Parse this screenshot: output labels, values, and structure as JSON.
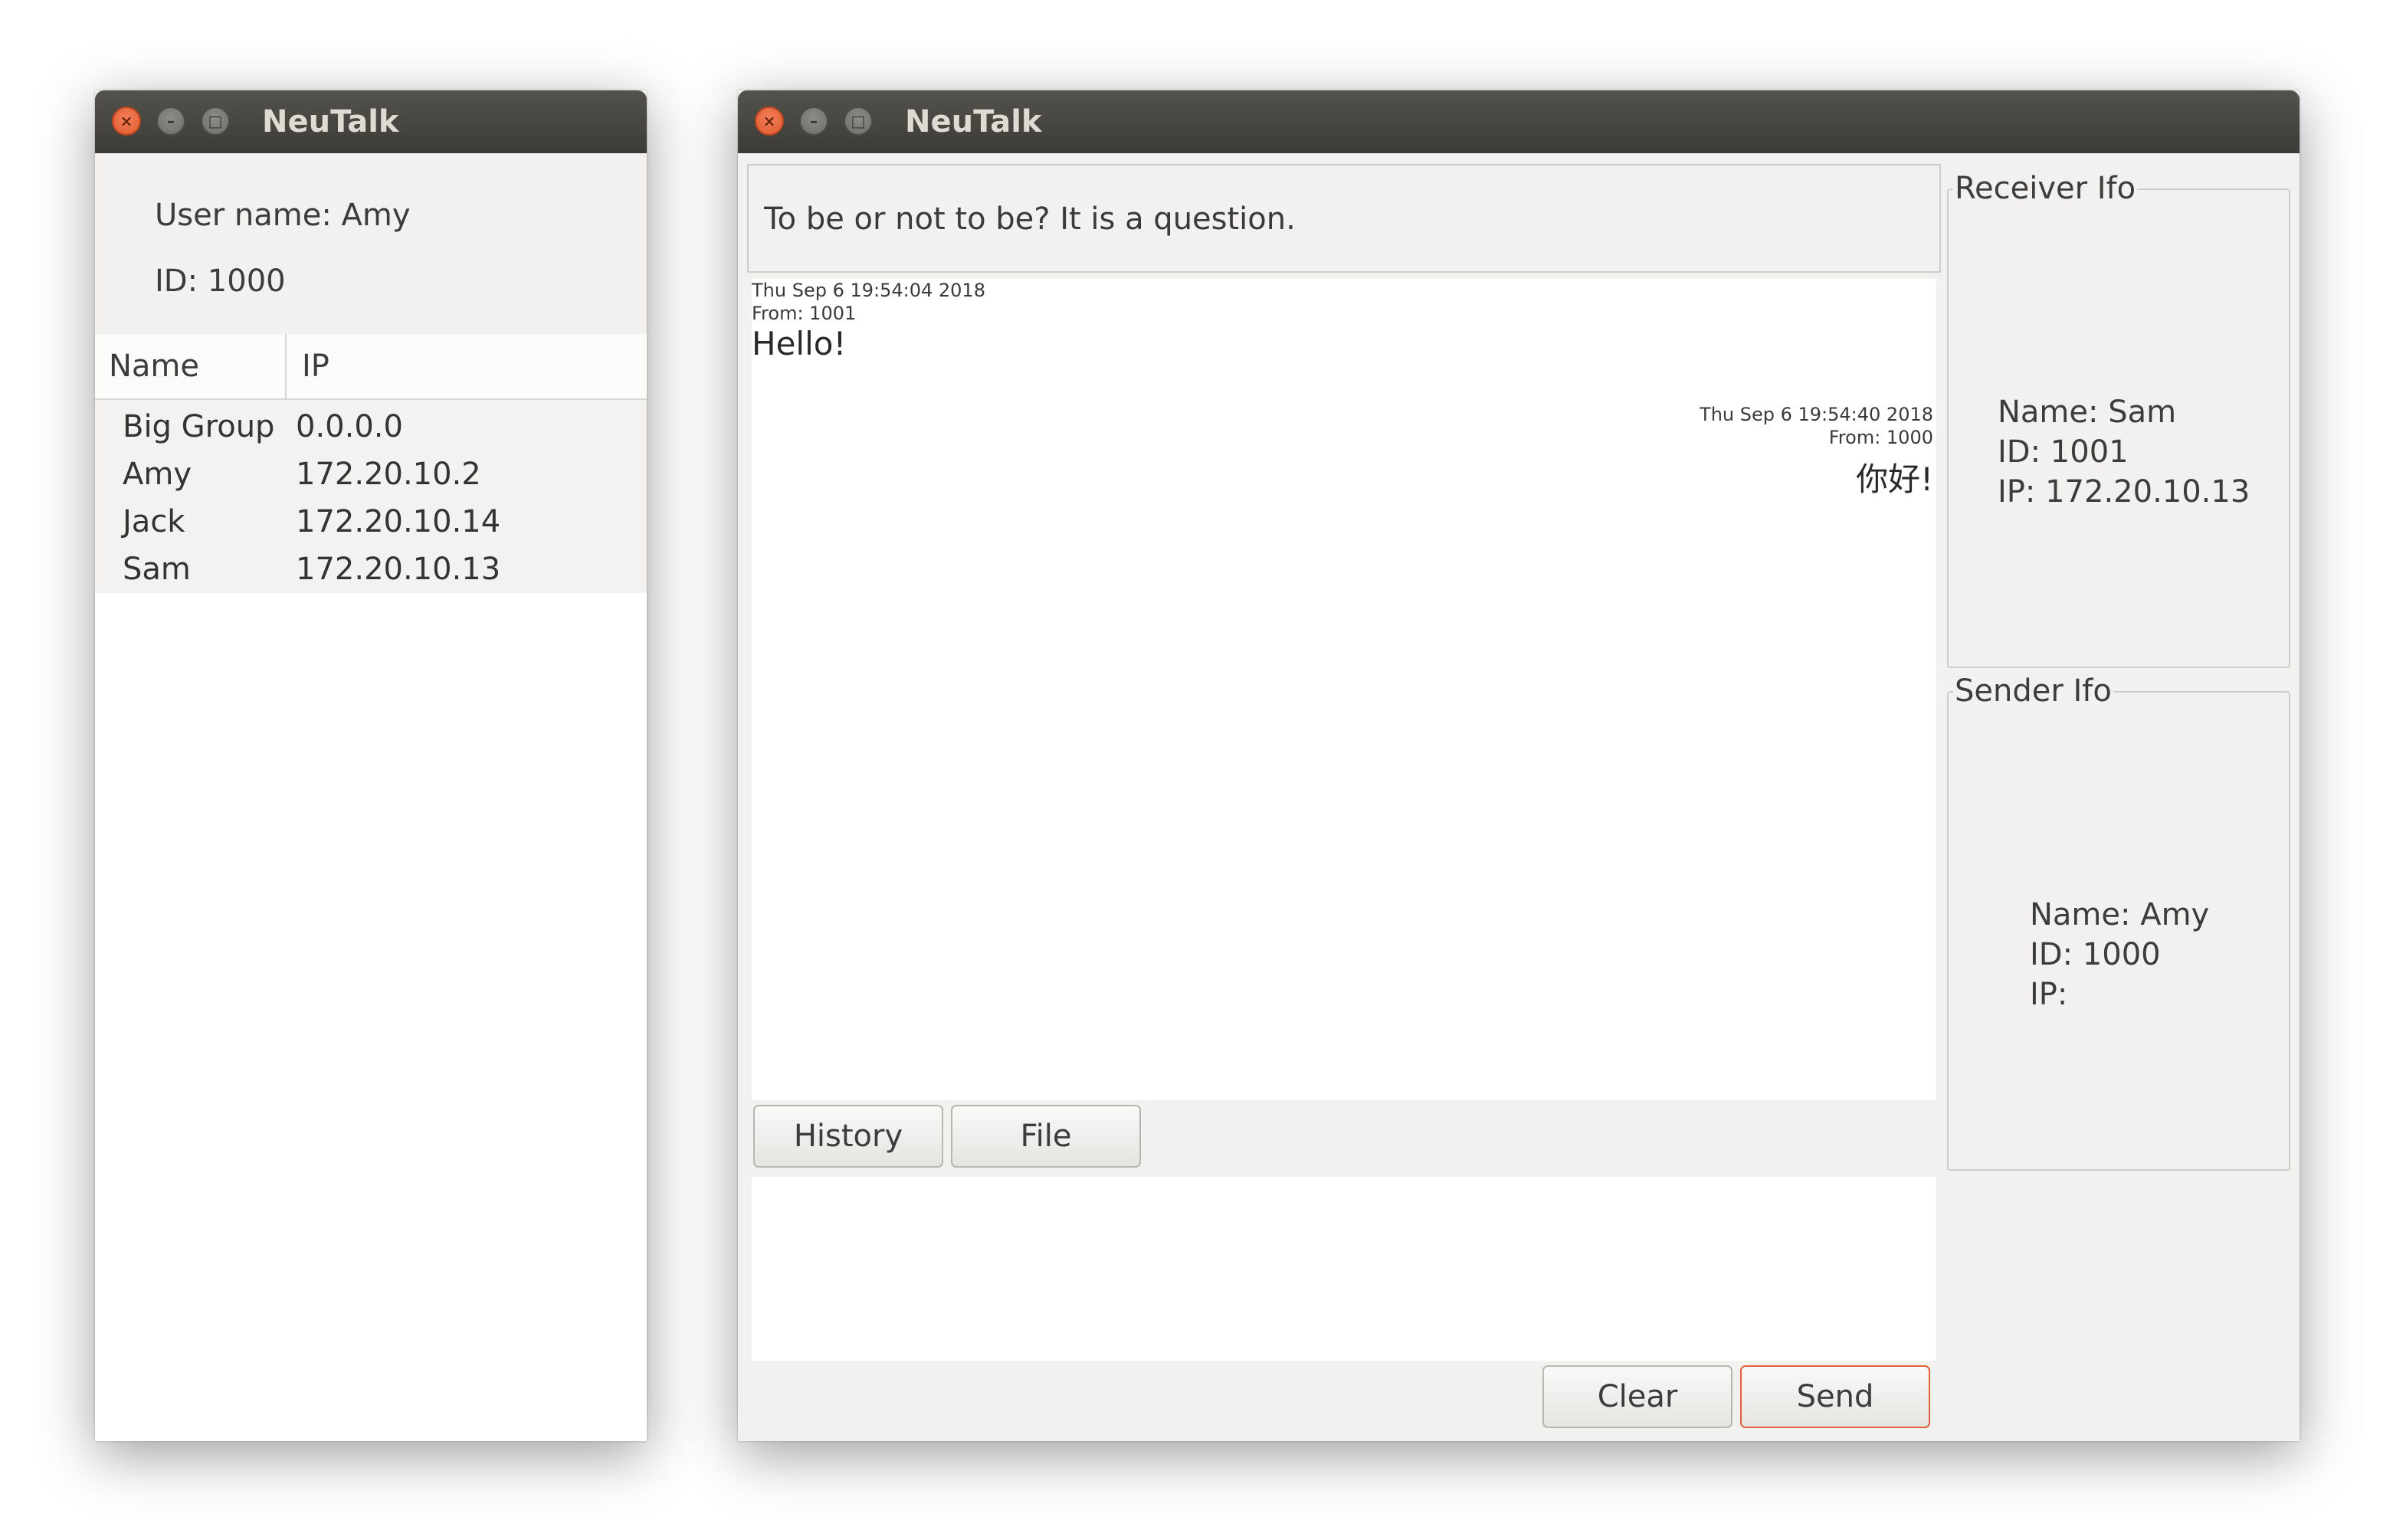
{
  "app": {
    "title": "NeuTalk"
  },
  "user_window": {
    "user_name": "User name: Amy",
    "user_id": "ID: 1000",
    "table": {
      "headers": {
        "name": "Name",
        "ip": "IP"
      },
      "rows": [
        {
          "name": "Big Group",
          "ip": "0.0.0.0"
        },
        {
          "name": "Amy",
          "ip": "172.20.10.2"
        },
        {
          "name": "Jack",
          "ip": "172.20.10.14"
        },
        {
          "name": "Sam",
          "ip": "172.20.10.13"
        }
      ]
    }
  },
  "chat_window": {
    "topic": "To be or not to be? It is a question.",
    "messages": [
      {
        "timestamp": "Thu Sep  6 19:54:04 2018",
        "from": "From: 1001",
        "text": "Hello!",
        "align": "left"
      },
      {
        "timestamp": "Thu Sep  6 19:54:40 2018",
        "from": "From: 1000",
        "text": "你好!",
        "align": "right"
      }
    ],
    "buttons": {
      "history": "History",
      "file": "File",
      "clear": "Clear",
      "send": "Send"
    },
    "input_value": "",
    "receiver": {
      "title": "Receiver Ifo",
      "name": "Name: Sam",
      "id": "ID: 1001",
      "ip": "IP: 172.20.10.13"
    },
    "sender": {
      "title": "Sender Ifo",
      "name": "Name: Amy",
      "id": "ID: 1000",
      "ip": "IP:"
    }
  },
  "icons": {
    "close": "close-icon",
    "minimize": "minimize-icon",
    "maximize": "maximize-icon"
  },
  "colors": {
    "close_button": "#e05a2b",
    "titlebar": "#3c3b37",
    "default_button_border": "#e0603a"
  }
}
